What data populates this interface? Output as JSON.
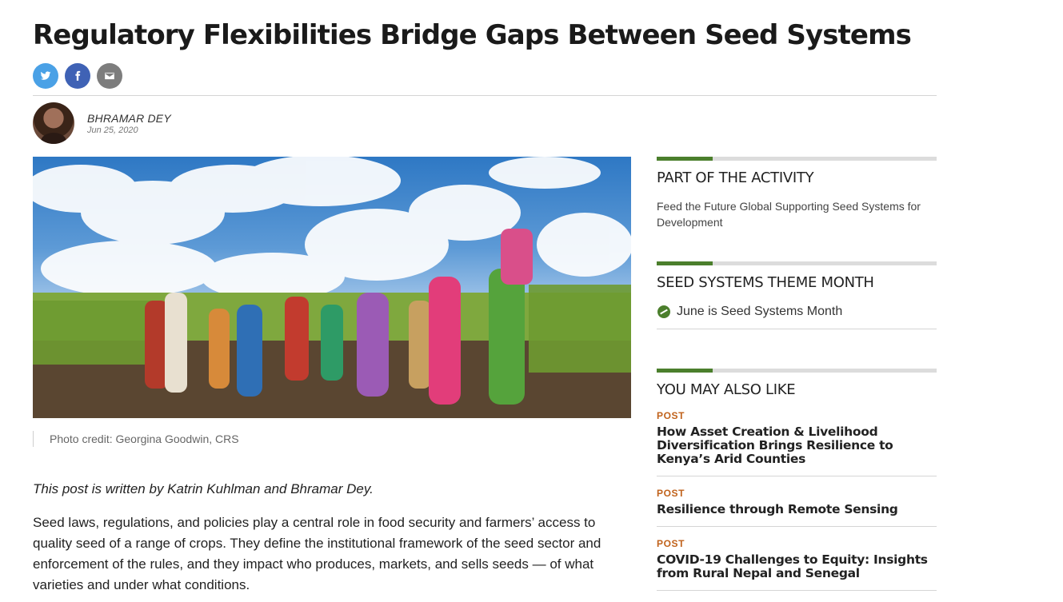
{
  "article": {
    "title": "Regulatory Flexibilities Bridge Gaps Between Seed Systems",
    "author_name": "BHRAMAR DEY",
    "date": "Jun 25, 2020",
    "photo_credit": "Photo credit: Georgina Goodwin, CRS",
    "intro": "This post is written by Katrin Kuhlman and Bhramar Dey.",
    "paragraph_1": "Seed laws, regulations, and policies play a central role in food security and farmers’ access to quality seed of a range of crops. They define the institutional framework of the seed sector and enforcement of the rules, and they impact who produces, markets, and sells seeds — of what varieties and under what conditions."
  },
  "share": {
    "icons": [
      "twitter-icon",
      "facebook-icon",
      "email-icon"
    ]
  },
  "sidebar": {
    "activity": {
      "heading": "PART OF THE ACTIVITY",
      "text": "Feed the Future Global Supporting Seed Systems for Development"
    },
    "theme": {
      "heading": "SEED SYSTEMS THEME MONTH",
      "link": "June is Seed Systems Month",
      "icon": "leaf-icon"
    },
    "related": {
      "heading": "YOU MAY ALSO LIKE",
      "items": [
        {
          "kind": "POST",
          "title": "How Asset Creation & Livelihood Diversification Brings Resilience to Kenya’s Arid Counties"
        },
        {
          "kind": "POST",
          "title": "Resilience through Remote Sensing"
        },
        {
          "kind": "POST",
          "title": "COVID-19 Challenges to Equity: Insights from Rural Nepal and Senegal"
        }
      ]
    }
  },
  "colors": {
    "accent_green": "#4b7f2c",
    "post_label": "#c0621b",
    "twitter": "#4aa1e6",
    "facebook": "#3f62b5",
    "email": "#7d7d7d"
  }
}
